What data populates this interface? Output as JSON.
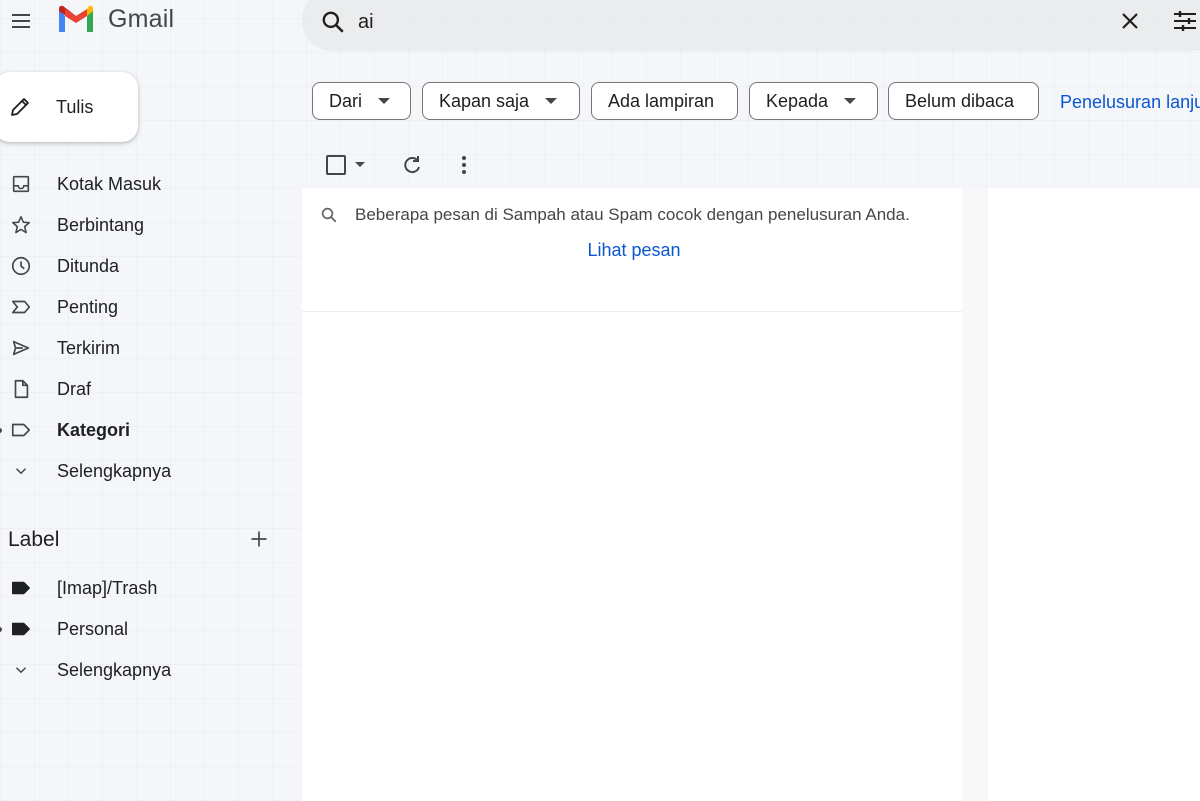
{
  "app": {
    "name": "Gmail"
  },
  "search": {
    "value": "ai"
  },
  "compose": {
    "label": "Tulis"
  },
  "nav": {
    "items": [
      {
        "label": "Kotak Masuk",
        "icon": "inbox-icon"
      },
      {
        "label": "Berbintang",
        "icon": "star-icon"
      },
      {
        "label": "Ditunda",
        "icon": "clock-icon"
      },
      {
        "label": "Penting",
        "icon": "important-icon"
      },
      {
        "label": "Terkirim",
        "icon": "send-icon"
      },
      {
        "label": "Draf",
        "icon": "draft-icon"
      },
      {
        "label": "Kategori",
        "icon": "label-outline-icon"
      },
      {
        "label": "Selengkapnya",
        "icon": "chevron-down-icon"
      }
    ]
  },
  "labels": {
    "title": "Label",
    "items": [
      {
        "label": "[Imap]/Trash",
        "icon": "label-icon"
      },
      {
        "label": "Personal",
        "icon": "label-icon"
      },
      {
        "label": "Selengkapnya",
        "icon": "chevron-down-icon"
      }
    ]
  },
  "filters": {
    "chips": [
      {
        "label": "Dari",
        "has_dropdown": true
      },
      {
        "label": "Kapan saja",
        "has_dropdown": true
      },
      {
        "label": "Ada lampiran",
        "has_dropdown": false
      },
      {
        "label": "Kepada",
        "has_dropdown": true
      },
      {
        "label": "Belum dibaca",
        "has_dropdown": false
      }
    ],
    "advanced_link": "Penelusuran lanjutan"
  },
  "notice": {
    "text": "Beberapa pesan di Sampah atau Spam cocok dengan penelusuran Anda.",
    "link": "Lihat pesan"
  },
  "colors": {
    "accent": "#0b57d0",
    "compose_bg": "#ffffff",
    "search_bg": "#e8eaed"
  }
}
